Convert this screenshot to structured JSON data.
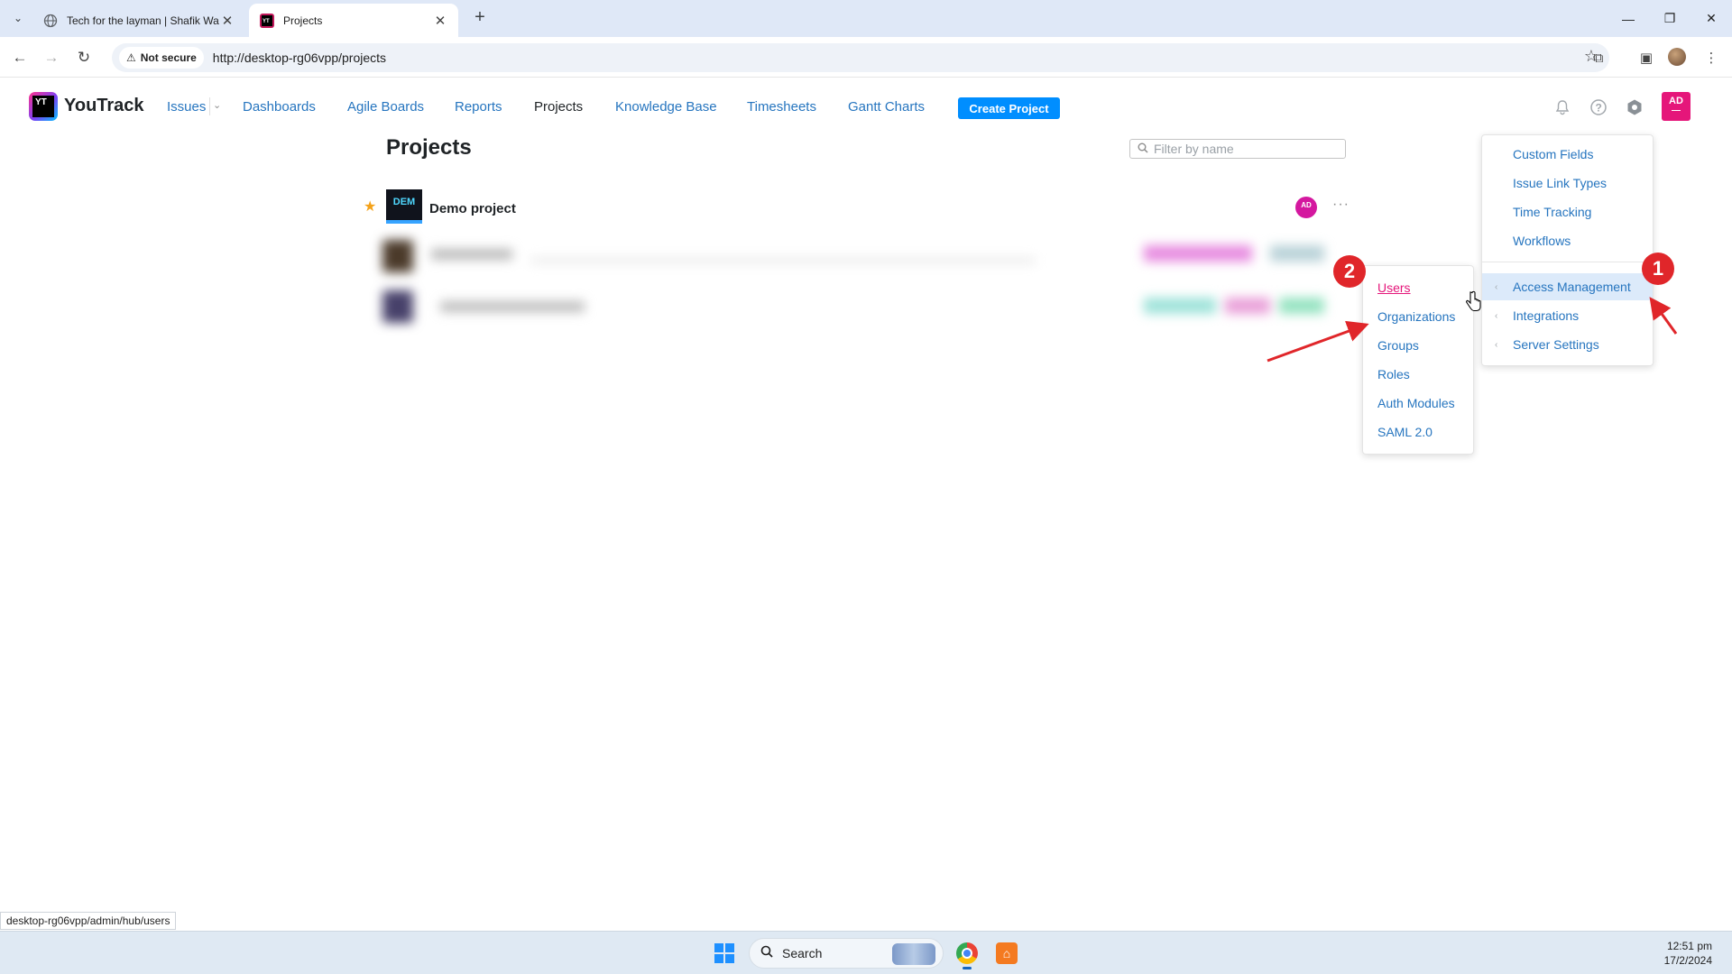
{
  "browser": {
    "tabs": [
      {
        "title": "Tech for the layman | Shafik Wa",
        "active": false
      },
      {
        "title": "Projects",
        "active": true
      }
    ],
    "security_label": "Not secure",
    "url": "http://desktop-rg06vpp/projects",
    "status_url": "desktop-rg06vpp/admin/hub/users"
  },
  "header": {
    "brand": "YouTrack",
    "nav": [
      "Issues",
      "Dashboards",
      "Agile Boards",
      "Reports",
      "Projects",
      "Knowledge Base",
      "Timesheets",
      "Gantt Charts"
    ],
    "current_nav": "Projects",
    "create_button": "Create Project",
    "avatar_initials": "AD"
  },
  "page": {
    "title": "Projects",
    "filter_placeholder": "Filter by name",
    "projects": [
      {
        "key": "DEM",
        "name": "Demo project",
        "starred": true,
        "owner_initials": "AD"
      }
    ]
  },
  "admin_menu": {
    "items": [
      "Custom Fields",
      "Issue Link Types",
      "Time Tracking",
      "Workflows"
    ],
    "submenu_items": [
      "Access Management",
      "Integrations",
      "Server Settings"
    ],
    "highlighted": "Access Management"
  },
  "access_submenu": {
    "items": [
      "Users",
      "Organizations",
      "Groups",
      "Roles",
      "Auth Modules",
      "SAML 2.0"
    ],
    "hovered": "Users"
  },
  "annotations": {
    "badge1": "1",
    "badge2": "2",
    "color": "#e0262a"
  },
  "taskbar": {
    "search_label": "Search",
    "time": "12:51 pm",
    "date": "17/2/2024"
  },
  "colors": {
    "link": "#2675bf",
    "primary_button": "#008eff",
    "avatar": "#e5167a",
    "highlight": "#dceafa"
  }
}
